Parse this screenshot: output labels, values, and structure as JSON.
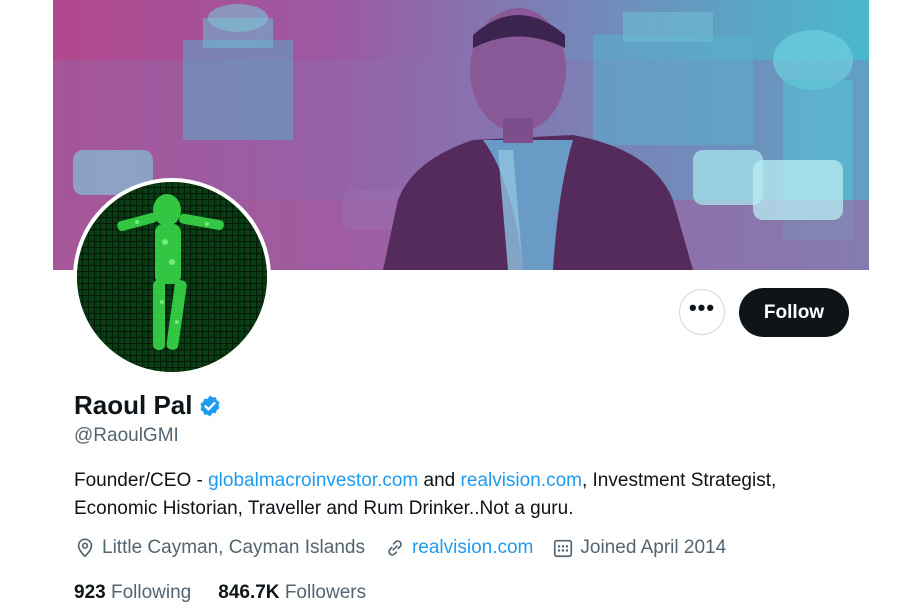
{
  "profile": {
    "name": "Raoul Pal",
    "handle": "@RaoulGMI",
    "bio": {
      "prefix": "Founder/CEO - ",
      "link1": "globalmacroinvestor.com",
      "mid": " and ",
      "link2": "realvision.com",
      "suffix": ", Investment Strategist, Economic Historian, Traveller and Rum Drinker..Not a guru."
    },
    "location": "Little Cayman, Cayman Islands",
    "website": "realvision.com",
    "joined": "Joined April 2014",
    "following_count": "923",
    "following_label": "Following",
    "followers_count": "846.7K",
    "followers_label": "Followers"
  },
  "actions": {
    "more_label": "•••",
    "follow_label": "Follow"
  },
  "icons": {
    "more": "more-dots-icon",
    "verified": "verified-badge-icon",
    "location": "location-pin-icon",
    "website": "link-icon",
    "joined": "calendar-icon"
  },
  "colors": {
    "accent": "#1d9bf0",
    "button_bg": "#0f1419",
    "muted_text": "#536471",
    "banner_tint_pink": "#b2478d",
    "banner_tint_cyan": "#49b9cf"
  }
}
